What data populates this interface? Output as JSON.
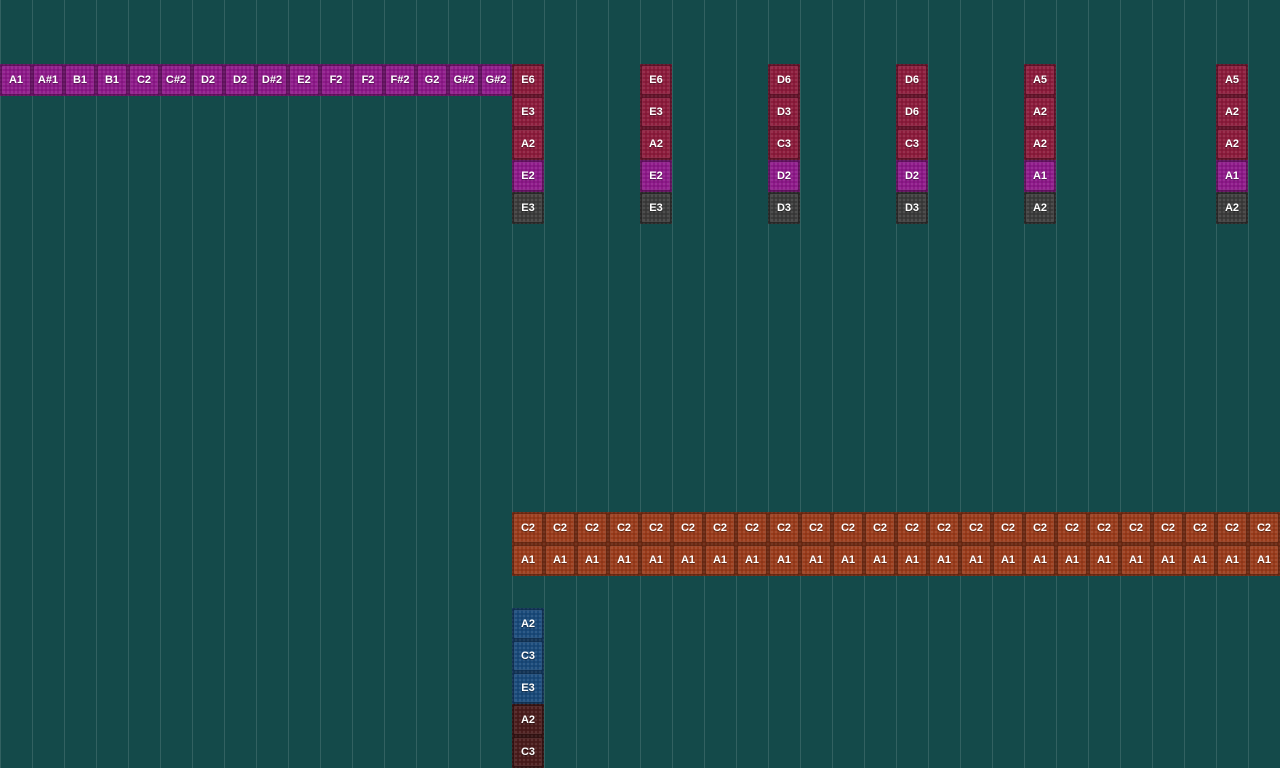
{
  "colors": {
    "background": "#144a4a",
    "purple": "#8e1a8a",
    "crimson": "#8c1c3c",
    "gray": "#3c3c3c",
    "orange": "#9a3c1c",
    "blue": "#1a4a7a",
    "maroon": "#4a1c1c"
  },
  "rows": [
    {
      "name": "purple-run",
      "color": "purple",
      "notes": [
        "A1",
        "A#1",
        "B1",
        "B1",
        "C2",
        "C#2",
        "D2",
        "D2",
        "D#2",
        "E2",
        "F2",
        "F2",
        "F#2",
        "G2",
        "G#2",
        "G#2"
      ]
    },
    {
      "name": "chord-stack",
      "stacks": [
        {
          "notes": [
            "E6",
            "E3",
            "A2",
            "E2",
            "E3"
          ],
          "colors": [
            "crimson",
            "crimson",
            "crimson",
            "purple",
            "gray"
          ]
        },
        {
          "notes": [
            "E6",
            "E3",
            "A2",
            "E2",
            "E3"
          ],
          "colors": [
            "crimson",
            "crimson",
            "crimson",
            "purple",
            "gray"
          ]
        },
        {
          "notes": [
            "D6",
            "D3",
            "C3",
            "D2",
            "D3"
          ],
          "colors": [
            "crimson",
            "crimson",
            "crimson",
            "purple",
            "gray"
          ]
        },
        {
          "notes": [
            "D6",
            "D6",
            "C3",
            "D2",
            "D3"
          ],
          "colors": [
            "crimson",
            "crimson",
            "crimson",
            "purple",
            "gray"
          ]
        },
        {
          "notes": [
            "A5",
            "A2",
            "A2",
            "A1",
            "A2"
          ],
          "colors": [
            "crimson",
            "crimson",
            "crimson",
            "purple",
            "gray"
          ]
        },
        {
          "notes": [
            "A5",
            "A2",
            "A2",
            "A1",
            "A2"
          ],
          "colors": [
            "crimson",
            "crimson",
            "crimson",
            "purple",
            "gray"
          ]
        }
      ]
    },
    {
      "name": "orange-c2-row",
      "color": "orange",
      "notes": [
        "C2",
        "C2",
        "C2",
        "C2",
        "C2",
        "C2",
        "C2",
        "C2",
        "C2",
        "C2",
        "C2",
        "C2",
        "C2",
        "C2",
        "C2",
        "C2",
        "C2",
        "C2",
        "C2",
        "C2",
        "C2",
        "C2",
        "C2",
        "C2"
      ]
    },
    {
      "name": "orange-a1-row",
      "color": "orange",
      "notes": [
        "A1",
        "A1",
        "A1",
        "A1",
        "A1",
        "A1",
        "A1",
        "A1",
        "A1",
        "A1",
        "A1",
        "A1",
        "A1",
        "A1",
        "A1",
        "A1",
        "A1",
        "A1",
        "A1",
        "A1",
        "A1",
        "A1",
        "A1",
        "A1"
      ]
    },
    {
      "name": "bottom-stack",
      "notes": [
        "A2",
        "C3",
        "E3",
        "A2",
        "C3"
      ],
      "colors": [
        "blue",
        "blue",
        "blue",
        "maroon",
        "maroon"
      ]
    }
  ]
}
